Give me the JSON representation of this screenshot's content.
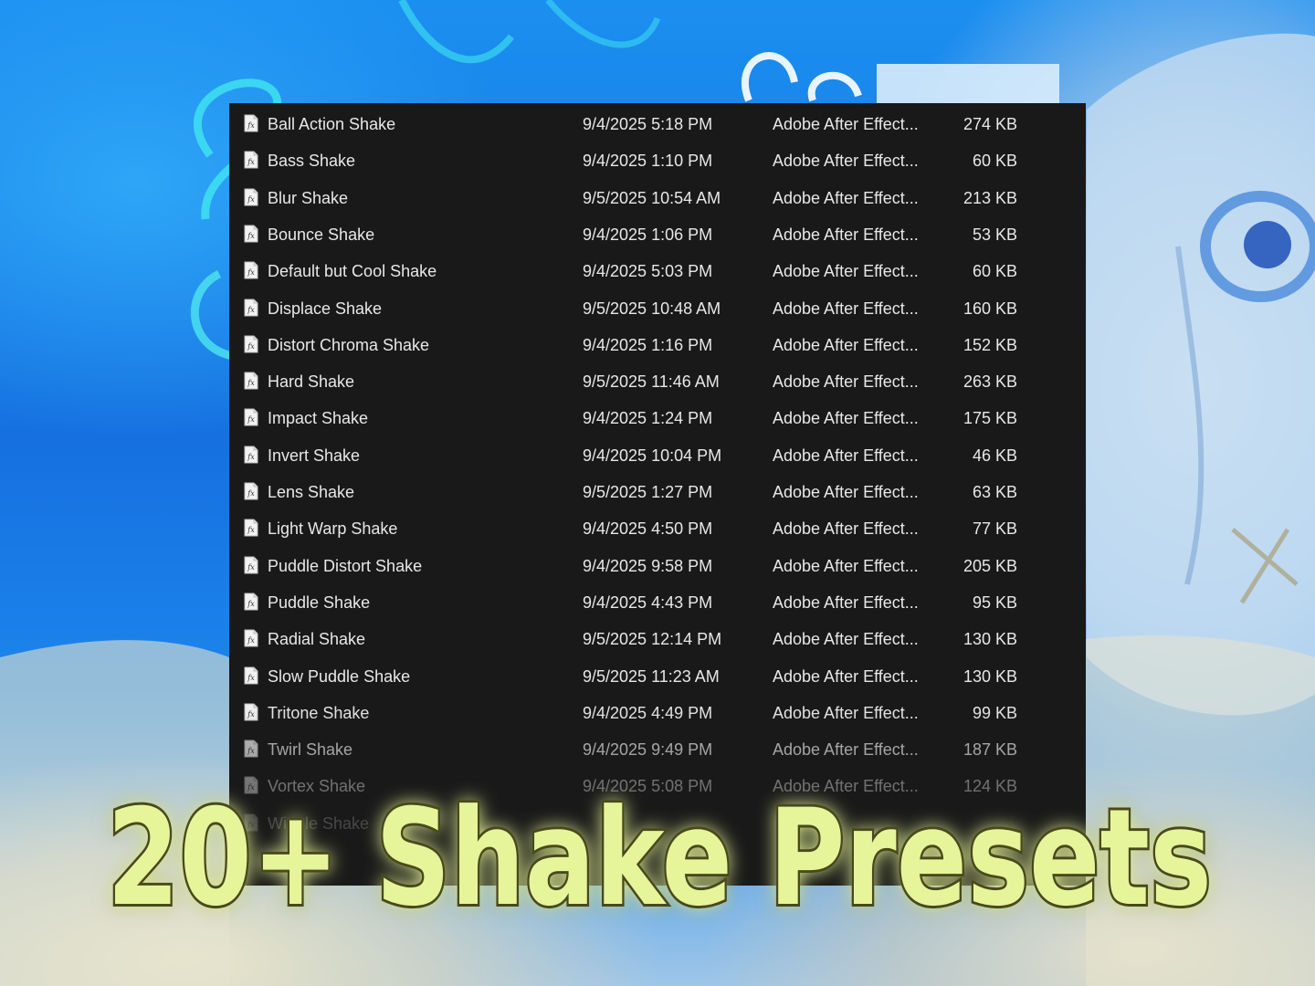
{
  "colors": {
    "panel_bg": "#191919",
    "text": "#e8e8e8",
    "title_fill": "#e7f59a",
    "title_outline": "#4a4a1c",
    "sky_blue": "#1f86ea"
  },
  "icons": {
    "file_icon": "fx-preset-file-icon"
  },
  "files": [
    {
      "name": "Ball Action Shake",
      "date": "9/4/2025 5:18 PM",
      "type": "Adobe After Effect...",
      "size": "274 KB"
    },
    {
      "name": "Bass Shake",
      "date": "9/4/2025 1:10 PM",
      "type": "Adobe After Effect...",
      "size": "60 KB"
    },
    {
      "name": "Blur Shake",
      "date": "9/5/2025 10:54 AM",
      "type": "Adobe After Effect...",
      "size": "213 KB"
    },
    {
      "name": "Bounce Shake",
      "date": "9/4/2025 1:06 PM",
      "type": "Adobe After Effect...",
      "size": "53 KB"
    },
    {
      "name": "Default but Cool Shake",
      "date": "9/4/2025 5:03 PM",
      "type": "Adobe After Effect...",
      "size": "60 KB"
    },
    {
      "name": "Displace Shake",
      "date": "9/5/2025 10:48 AM",
      "type": "Adobe After Effect...",
      "size": "160 KB"
    },
    {
      "name": "Distort Chroma Shake",
      "date": "9/4/2025 1:16 PM",
      "type": "Adobe After Effect...",
      "size": "152 KB"
    },
    {
      "name": "Hard Shake",
      "date": "9/5/2025 11:46 AM",
      "type": "Adobe After Effect...",
      "size": "263 KB"
    },
    {
      "name": "Impact Shake",
      "date": "9/4/2025 1:24 PM",
      "type": "Adobe After Effect...",
      "size": "175 KB"
    },
    {
      "name": "Invert Shake",
      "date": "9/4/2025 10:04 PM",
      "type": "Adobe After Effect...",
      "size": "46 KB"
    },
    {
      "name": "Lens Shake",
      "date": "9/5/2025 1:27 PM",
      "type": "Adobe After Effect...",
      "size": "63 KB"
    },
    {
      "name": "Light Warp Shake",
      "date": "9/4/2025 4:50 PM",
      "type": "Adobe After Effect...",
      "size": "77 KB"
    },
    {
      "name": "Puddle Distort Shake",
      "date": "9/4/2025 9:58 PM",
      "type": "Adobe After Effect...",
      "size": "205 KB"
    },
    {
      "name": "Puddle Shake",
      "date": "9/4/2025 4:43 PM",
      "type": "Adobe After Effect...",
      "size": "95 KB"
    },
    {
      "name": "Radial Shake",
      "date": "9/5/2025 12:14 PM",
      "type": "Adobe After Effect...",
      "size": "130 KB"
    },
    {
      "name": "Slow Puddle Shake",
      "date": "9/5/2025 11:23 AM",
      "type": "Adobe After Effect...",
      "size": "130 KB"
    },
    {
      "name": "Tritone Shake",
      "date": "9/4/2025 4:49 PM",
      "type": "Adobe After Effect...",
      "size": "99 KB"
    },
    {
      "name": "Twirl Shake",
      "date": "9/4/2025 9:49 PM",
      "type": "Adobe After Effect...",
      "size": "187 KB"
    },
    {
      "name": "Vortex Shake",
      "date": "9/4/2025 5:08 PM",
      "type": "Adobe After Effect...",
      "size": "124 KB"
    },
    {
      "name": "Wiggle Shake",
      "date": "",
      "type": "",
      "size": ""
    }
  ],
  "title": {
    "text": "20+ Shake Presets"
  }
}
